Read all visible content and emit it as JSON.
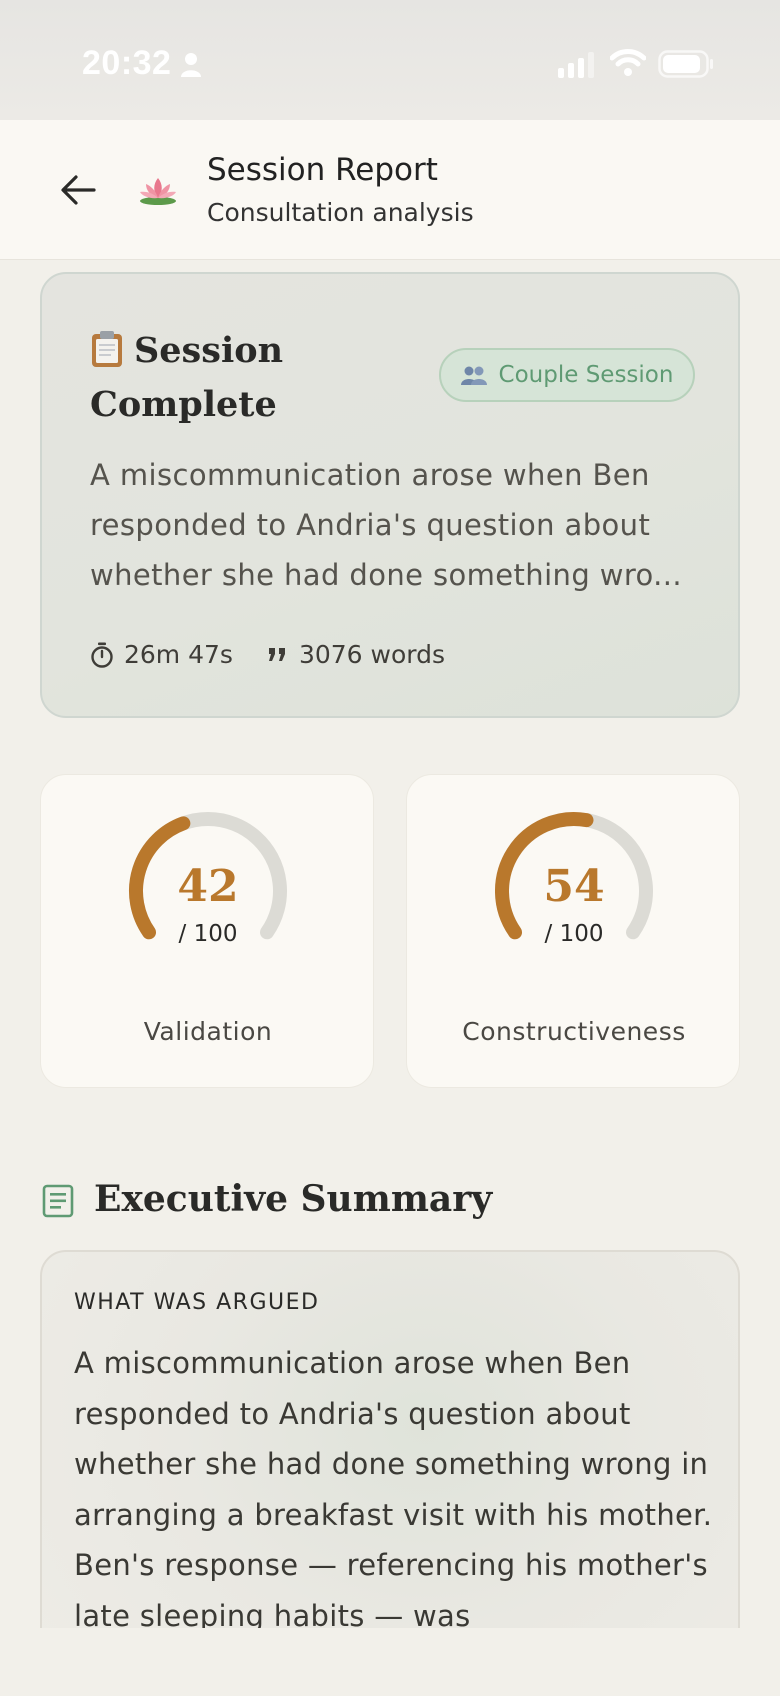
{
  "status_bar": {
    "time": "20:32",
    "icons": [
      "person-icon",
      "signal-icon",
      "wifi-icon",
      "battery-icon"
    ]
  },
  "header": {
    "back_icon": "arrow-left-icon",
    "logo_icon": "lotus-icon",
    "title": "Session Report",
    "subtitle": "Consultation analysis"
  },
  "session_card": {
    "title": "Session Complete",
    "title_icon": "clipboard-icon",
    "badge": {
      "label": "Couple Session",
      "icon": "people-icon",
      "color": "#5f9a73"
    },
    "summary": "A miscommunication arose when Ben responded to Andria's question about whether she had done something wro...",
    "duration": "26m 47s",
    "word_count": "3076 words"
  },
  "scores": [
    {
      "label": "Validation",
      "value": "42",
      "max": "/ 100",
      "fraction": 0.42
    },
    {
      "label": "Constructiveness",
      "value": "54",
      "max": "/ 100",
      "fraction": 0.54
    }
  ],
  "colors": {
    "accent": "#b9782c",
    "track": "#dcdbd5",
    "green": "#5f9a73"
  },
  "executive_summary": {
    "title": "Executive Summary",
    "icon": "document-icon",
    "section_label": "WHAT WAS ARGUED",
    "text": "A miscommunication arose when Ben responded to Andria's question about whether she had done something wrong in arranging a breakfast visit with his mother. Ben's response — referencing his mother's late sleeping habits — was"
  }
}
